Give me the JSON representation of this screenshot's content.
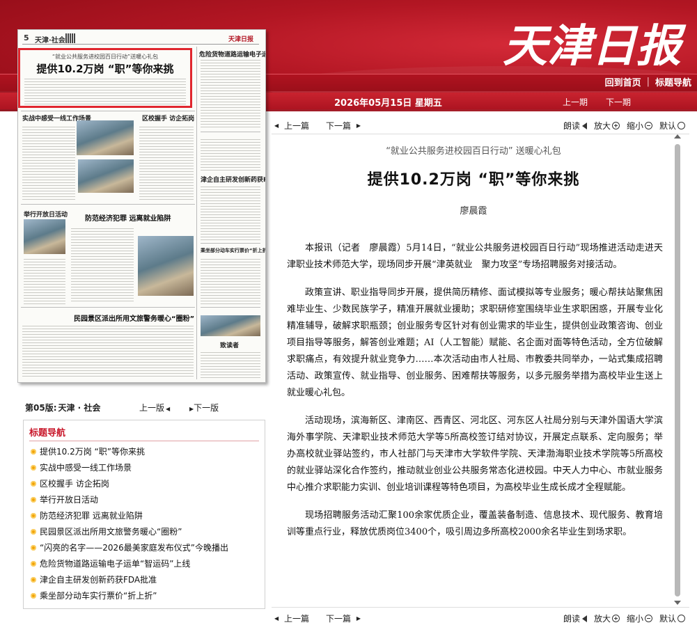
{
  "header": {
    "logo_text": "天津日报",
    "nav": {
      "home": "回到首页",
      "separator": "|",
      "topics": "标题导航"
    },
    "date": "2026年05月15日",
    "weekday": "星期五",
    "prev_issue": "上一期",
    "next_issue": "下一期"
  },
  "newspaper_page": {
    "page_number": "5",
    "section": "天津·社会",
    "masthead": "天津日报",
    "highlight_subtitle": "“就业公共服务进校园百日行动”送暖心礼包",
    "highlight_title": "提供10.2万岗 “职”等你来挑",
    "headlines": [
      "实战中感受一线工作场景",
      "区校握手 访企拓岗",
      "危险货物道路运输电子运单“智运码”上线",
      "津企自主研发创新药获FDA批准",
      "举行开放日活动",
      "防范经济犯罪 远离就业陷阱",
      "乘坐部分动车实行票价“折上折”",
      "民园景区派出所用文旅警务暖心“圈粉”",
      "致读者"
    ]
  },
  "page_nav": {
    "label": "第05版:",
    "section": "天津 · 社会",
    "prev_page": "上一版",
    "next_page": "下一版"
  },
  "toc": {
    "title": "标题导航",
    "items": [
      "提供10.2万岗 “职”等你来挑",
      "实战中感受一线工作场景",
      "区校握手 访企拓岗",
      "举行开放日活动",
      "防范经济犯罪 远离就业陷阱",
      "民园景区派出所用文旅警务暖心“圈粉”",
      "“闪亮的名字——2026最美家庭发布仪式”今晚播出",
      "危险货物道路运输电子运单“智运码”上线",
      "津企自主研发创新药获FDA批准",
      "乘坐部分动车实行票价“折上折”"
    ]
  },
  "toolbar": {
    "prev_article": "上一篇",
    "next_article": "下一篇",
    "read_aloud": "朗读",
    "zoom_in": "放大",
    "zoom_out": "缩小",
    "default": "默认"
  },
  "article": {
    "subtitle": "“就业公共服务进校园百日行动” 送暖心礼包",
    "title": "提供10.2万岗 “职”等你来挑",
    "author": "廖晨霞",
    "paragraphs": [
      "本报讯（记者　廖晨霞）5月14日，“就业公共服务进校园百日行动”现场推进活动走进天津职业技术师范大学，现场同步开展“津英就业　聚力攻坚”专场招聘服务对接活动。",
      "政策宣讲、职业指导同步开展，提供简历精修、面试模拟等专业服务；暖心帮扶站聚焦困难毕业生、少数民族学子，精准开展就业援助；求职研修室围绕毕业生求职困惑，开展专业化精准辅导，破解求职瓶颈；创业服务专区针对有创业需求的毕业生，提供创业政策咨询、创业项目指导等服务，解答创业难题；AI（人工智能）赋能、名企面对面等特色活动，全方位破解求职痛点，有效提升就业竞争力……本次活动由市人社局、市教委共同举办，一站式集成招聘活动、政策宣传、就业指导、创业服务、困难帮扶等服务，以多元服务举措为高校毕业生送上就业暖心礼包。",
      "活动现场，滨海新区、津南区、西青区、河北区、河东区人社局分别与天津外国语大学滨海外事学院、天津职业技术师范大学等5所高校签订结对协议，开展定点联系、定向服务；举办高校就业驿站签约，市人社部门与天津市大学软件学院、天津渤海职业技术学院等5所高校的就业驿站深化合作签约，推动就业创业公共服务常态化进校园。中天人力中心、市就业服务中心推介求职能力实训、创业培训课程等特色项目，为高校毕业生成长成才全程赋能。",
      "现场招聘服务活动汇聚100余家优质企业，覆盖装备制造、信息技术、现代服务、教育培训等重点行业，释放优质岗位3400个，吸引周边多所高校2000余名毕业生到场求职。"
    ]
  },
  "colors": {
    "header_red": "#b21623",
    "toc_title_red": "#c8172a",
    "highlight_border": "#e0262e",
    "bullet_orange": "#f2a50b"
  }
}
